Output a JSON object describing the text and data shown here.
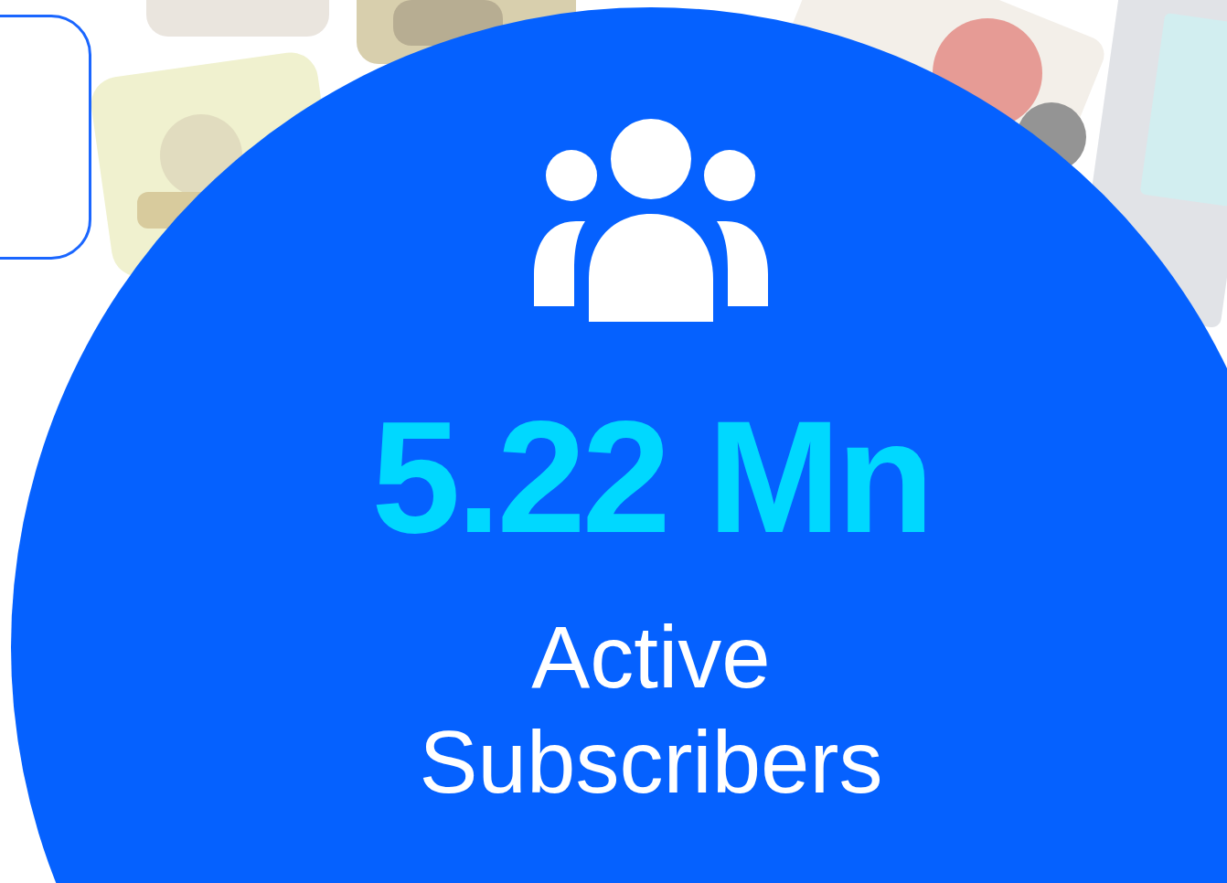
{
  "stat": {
    "value": "5.22 Mn",
    "label": "Active Subscribers"
  }
}
